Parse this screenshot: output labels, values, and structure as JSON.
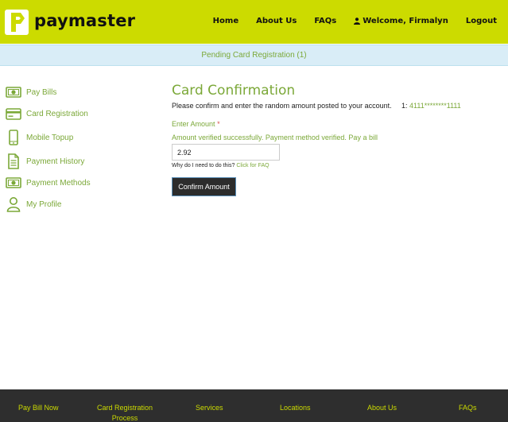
{
  "brand": {
    "name": "paymaster",
    "color": "#ccdb00",
    "accent": "#7ba838"
  },
  "nav": {
    "home": "Home",
    "about": "About Us",
    "faqs": "FAQs",
    "welcome": "Welcome, Firmalyn",
    "logout": "Logout"
  },
  "pending": {
    "text": "Pending Card Registration (1)"
  },
  "sidebar": {
    "items": [
      {
        "label": "Pay Bills",
        "icon": "money-icon"
      },
      {
        "label": "Card Registration",
        "icon": "credit-card-icon"
      },
      {
        "label": "Mobile Topup",
        "icon": "mobile-phone-icon"
      },
      {
        "label": "Payment History",
        "icon": "document-icon"
      },
      {
        "label": "Payment Methods",
        "icon": "money-icon"
      },
      {
        "label": "My Profile",
        "icon": "user-icon"
      }
    ]
  },
  "main": {
    "title": "Card Confirmation",
    "instructions": "Please confirm and enter the random amount posted to your account.",
    "card_prefix": "1:",
    "card_number": "4111********1111",
    "enter_label": "Enter Amount",
    "required_mark": "*",
    "verified_message": "Amount verified successfully. Payment method verified. Pay a bill",
    "amount_value": "2.92",
    "why_text": "Why do I need to do this?",
    "faq_link": "Click for FAQ",
    "confirm_label": "Confirm Amount"
  },
  "footer": {
    "links": [
      "Pay Bill Now",
      "Card Registration",
      "Process",
      "Services",
      "Locations",
      "About Us",
      "FAQs"
    ]
  }
}
